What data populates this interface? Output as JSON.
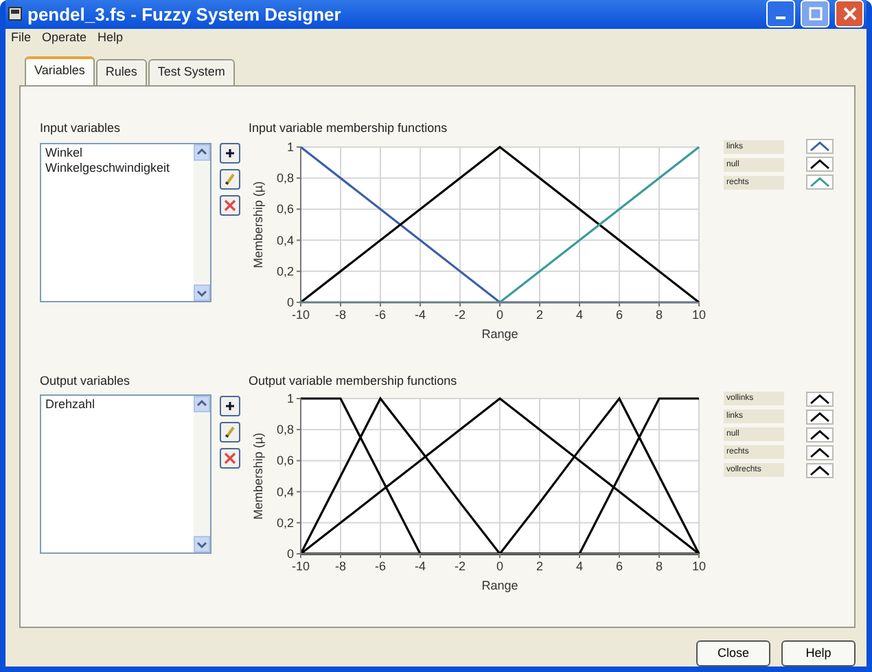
{
  "window": {
    "title": "pendel_3.fs - Fuzzy System Designer"
  },
  "menu": [
    "File",
    "Operate",
    "Help"
  ],
  "tabs": [
    {
      "label": "Variables",
      "selected": true
    },
    {
      "label": "Rules",
      "selected": false
    },
    {
      "label": "Test System",
      "selected": false
    }
  ],
  "sections": [
    {
      "list_label": "Input variables",
      "items": [
        "Winkel",
        "Winkelgeschwindigkeit"
      ],
      "chart_data": {
        "type": "line",
        "title": "Input variable membership functions",
        "xlabel": "Range",
        "ylabel": "Membership (µ)",
        "grid": true,
        "x": [
          -10,
          0,
          10
        ],
        "xlim": [
          -10,
          10
        ],
        "ylim": [
          0,
          1
        ],
        "xticks": [
          -10,
          -8,
          -6,
          -4,
          -2,
          0,
          2,
          4,
          6,
          8,
          10
        ],
        "yticks": [
          {
            "value": 0,
            "label": "0"
          },
          {
            "value": 0.2,
            "label": "0,2"
          },
          {
            "value": 0.4,
            "label": "0,4"
          },
          {
            "value": 0.6,
            "label": "0,6"
          },
          {
            "value": 0.8,
            "label": "0,8"
          },
          {
            "value": 1,
            "label": "1"
          }
        ],
        "series": [
          {
            "name": "links",
            "color": "#3b5fa8",
            "values": [
              1,
              0,
              0
            ]
          },
          {
            "name": "null",
            "color": "#000000",
            "values": [
              0,
              1,
              0
            ]
          },
          {
            "name": "rechts",
            "color": "#3a9a9a",
            "values": [
              0,
              0,
              1
            ]
          }
        ]
      }
    },
    {
      "list_label": "Output variables",
      "items": [
        "Drehzahl"
      ],
      "chart_data": {
        "type": "line",
        "title": "Output variable membership functions",
        "xlabel": "Range",
        "ylabel": "Membership (µ)",
        "grid": true,
        "x": [
          -10,
          -8,
          -6,
          -4,
          -2,
          0,
          2,
          4,
          6,
          8,
          10
        ],
        "xlim": [
          -10,
          10
        ],
        "ylim": [
          0,
          1
        ],
        "xticks": [
          -10,
          -8,
          -6,
          -4,
          -2,
          0,
          2,
          4,
          6,
          8,
          10
        ],
        "yticks": [
          {
            "value": 0,
            "label": "0"
          },
          {
            "value": 0.2,
            "label": "0,2"
          },
          {
            "value": 0.4,
            "label": "0,4"
          },
          {
            "value": 0.6,
            "label": "0,6"
          },
          {
            "value": 0.8,
            "label": "0,8"
          },
          {
            "value": 1,
            "label": "1"
          }
        ],
        "series": [
          {
            "name": "vollinks",
            "color": "#000000",
            "values": [
              1,
              1,
              0.5,
              0,
              0,
              0,
              0,
              0,
              0,
              0,
              0
            ]
          },
          {
            "name": "links",
            "color": "#000000",
            "values": [
              0,
              0.5,
              1,
              0.67,
              0.33,
              0,
              0,
              0,
              0,
              0,
              0
            ]
          },
          {
            "name": "null",
            "color": "#000000",
            "values": [
              0,
              0.2,
              0.4,
              0.6,
              0.8,
              1,
              0.8,
              0.6,
              0.4,
              0.2,
              0
            ]
          },
          {
            "name": "rechts",
            "color": "#000000",
            "values": [
              0,
              0,
              0,
              0,
              0,
              0,
              0.33,
              0.67,
              1,
              0.5,
              0
            ]
          },
          {
            "name": "vollrechts",
            "color": "#000000",
            "values": [
              0,
              0,
              0,
              0,
              0,
              0,
              0,
              0,
              0.5,
              1,
              1
            ]
          }
        ]
      }
    }
  ],
  "buttons": [
    "Close",
    "Help"
  ]
}
